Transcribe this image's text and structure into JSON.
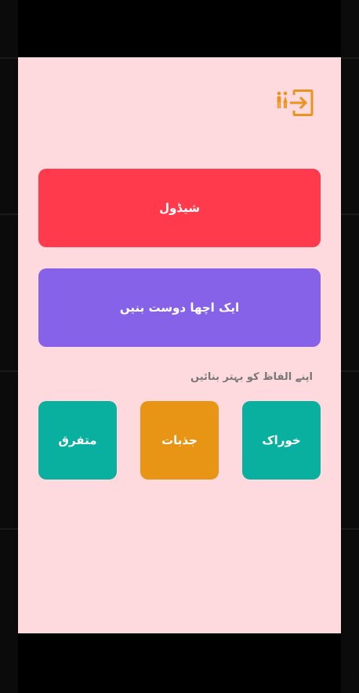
{
  "header": {
    "exit_icon": "restroom-exit-icon",
    "icon_color": "#e8941f"
  },
  "main": {
    "schedule_label": "شیڈول",
    "be_good_friend_label": "ایک اچھا دوست بنیں",
    "section_title": "اپنے الفاظ کو بہتر بنائیں",
    "categories": [
      {
        "label": "خوراک",
        "color": "#0ab09f"
      },
      {
        "label": "جذبات",
        "color": "#e89414"
      },
      {
        "label": "متفرق",
        "color": "#0ab09f"
      }
    ]
  },
  "colors": {
    "background": "#fed9dd",
    "schedule": "#ff3a4d",
    "friend": "#8662e8"
  }
}
